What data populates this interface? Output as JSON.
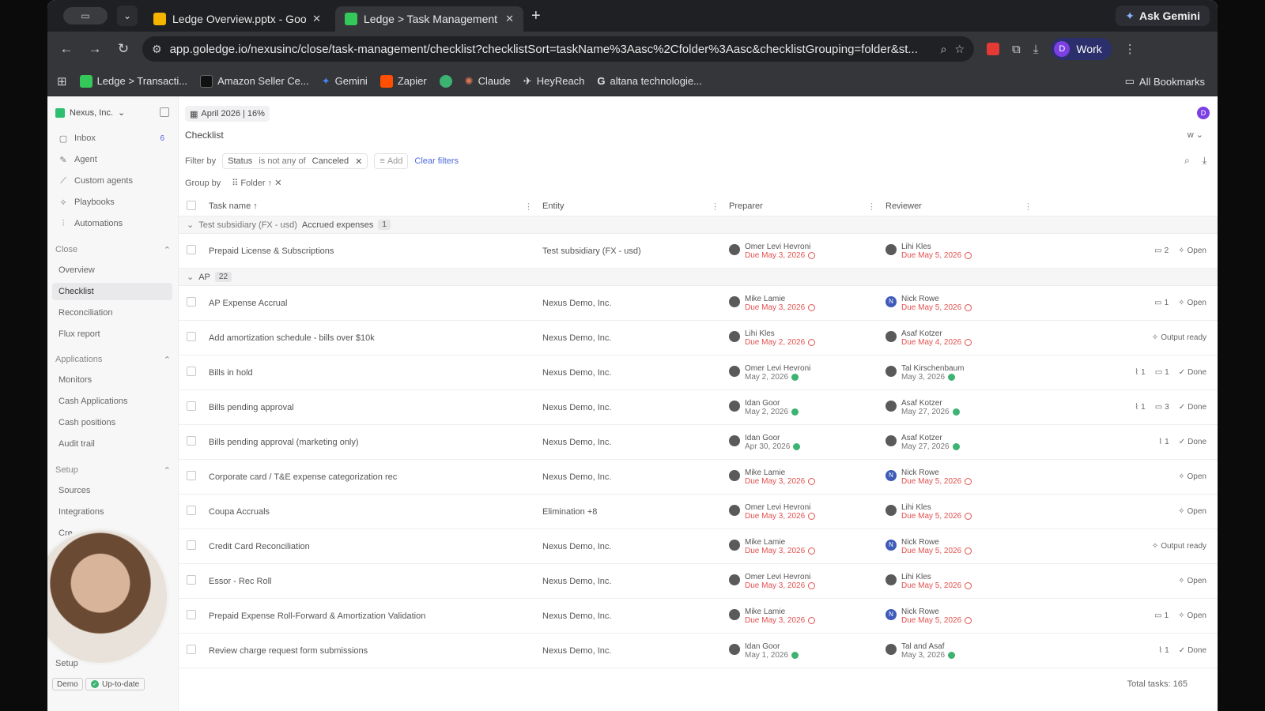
{
  "browser": {
    "tabs": [
      {
        "title": "Ledge Overview.pptx - Googl",
        "color": "#f4b400",
        "active": false
      },
      {
        "title": "Ledge > Task Management",
        "color": "#34c759",
        "active": true
      }
    ],
    "ask_gemini": "Ask Gemini",
    "url": "app.goledge.io/nexusinc/close/task-management/checklist?checklistSort=taskName%3Aasc%2Cfolder%3Aasc&checklistGrouping=folder&st...",
    "profile_label": "Work",
    "profile_initial": "D",
    "bookmarks": [
      {
        "label": "Ledge > Transacti...",
        "color": "#34c759"
      },
      {
        "label": "Amazon Seller Ce...",
        "color": "#111111"
      },
      {
        "label": "Gemini",
        "color": "#4285f4"
      },
      {
        "label": "Zapier",
        "color": "#ff4f00"
      },
      {
        "label": "",
        "color": "#3cb371"
      },
      {
        "label": "Claude",
        "color": "#d97757"
      },
      {
        "label": "HeyReach",
        "color": "#dddddd"
      },
      {
        "label": "altana technologie...",
        "color": "#ffffff"
      }
    ],
    "all_bookmarks": "All Bookmarks"
  },
  "sidebar": {
    "org": "Nexus, Inc.",
    "top_items": [
      {
        "label": "Inbox",
        "icon": "inbox-icon",
        "badge": "6"
      },
      {
        "label": "Agent",
        "icon": "agent-icon"
      },
      {
        "label": "Custom agents",
        "icon": "custom-agents-icon"
      },
      {
        "label": "Playbooks",
        "icon": "playbooks-icon"
      },
      {
        "label": "Automations",
        "icon": "automations-icon"
      }
    ],
    "close_label": "Close",
    "close_items": [
      "Overview",
      "Checklist",
      "Reconciliation",
      "Flux report"
    ],
    "applications_label": "Applications",
    "application_items": [
      "Monitors",
      "Cash Applications",
      "Cash positions",
      "Audit trail"
    ],
    "setup_label": "Setup",
    "setup_items": [
      "Sources",
      "Integrations",
      "Cre"
    ],
    "setup_bottom": "Setup",
    "demo": "Demo",
    "uptodate": "Up-to-date"
  },
  "main": {
    "period": "April 2026 | 16%",
    "title": "Checklist",
    "user_initial": "D",
    "view": "w",
    "filter": {
      "label": "Filter by",
      "field": "Status",
      "op": "is not any of",
      "value": "Canceled",
      "add": "Add",
      "clear": "Clear filters"
    },
    "group": {
      "label": "Group by",
      "value": "Folder"
    },
    "columns": {
      "task": "Task name",
      "entity": "Entity",
      "preparer": "Preparer",
      "reviewer": "Reviewer"
    },
    "total": "Total tasks: 165"
  },
  "groups": [
    {
      "path": "Test subsidiary (FX - usd)",
      "name": "Accrued expenses",
      "count": "1",
      "rows": [
        {
          "task": "Prepaid License & Subscriptions",
          "entity": "Test subsidiary (FX - usd)",
          "prep": "Omer Levi Hevroni",
          "prep_due": "Due May 3, 2026",
          "prep_done": false,
          "rev": "Lihi Kles",
          "rev_due": "Due May 5, 2026",
          "rev_done": false,
          "rev_n": false,
          "attach": "",
          "comments": "2",
          "status": "Open"
        }
      ]
    },
    {
      "path": "",
      "name": "AP",
      "count": "22",
      "rows": [
        {
          "task": "AP Expense Accrual",
          "entity": "Nexus Demo, Inc.",
          "prep": "Mike Lamie",
          "prep_due": "Due May 3, 2026",
          "prep_done": false,
          "rev": "Nick Rowe",
          "rev_due": "Due May 5, 2026",
          "rev_done": false,
          "rev_n": true,
          "attach": "",
          "comments": "1",
          "status": "Open"
        },
        {
          "task": "Add amortization schedule - bills over $10k",
          "entity": "Nexus Demo, Inc.",
          "prep": "Lihi Kles",
          "prep_due": "Due May 2, 2026",
          "prep_done": false,
          "rev": "Asaf Kotzer",
          "rev_due": "Due May 4, 2026",
          "rev_done": false,
          "rev_n": false,
          "attach": "",
          "comments": "",
          "status": "Output ready"
        },
        {
          "task": "Bills in hold",
          "entity": "Nexus Demo, Inc.",
          "prep": "Omer Levi Hevroni",
          "prep_due": "May 2, 2026",
          "prep_done": true,
          "rev": "Tal Kirschenbaum",
          "rev_due": "May 3, 2026",
          "rev_done": true,
          "rev_n": false,
          "attach": "1",
          "comments": "1",
          "status": "Done"
        },
        {
          "task": "Bills pending approval",
          "entity": "Nexus Demo, Inc.",
          "prep": "Idan Goor",
          "prep_due": "May 2, 2026",
          "prep_done": true,
          "rev": "Asaf Kotzer",
          "rev_due": "May 27, 2026",
          "rev_done": true,
          "rev_n": false,
          "attach": "1",
          "comments": "3",
          "status": "Done"
        },
        {
          "task": "Bills pending approval (marketing only)",
          "entity": "Nexus Demo, Inc.",
          "prep": "Idan Goor",
          "prep_due": "Apr 30, 2026",
          "prep_done": true,
          "rev": "Asaf Kotzer",
          "rev_due": "May 27, 2026",
          "rev_done": true,
          "rev_n": false,
          "attach": "1",
          "comments": "",
          "status": "Done"
        },
        {
          "task": "Corporate card / T&E expense categorization rec",
          "entity": "Nexus Demo, Inc.",
          "prep": "Mike Lamie",
          "prep_due": "Due May 3, 2026",
          "prep_done": false,
          "rev": "Nick Rowe",
          "rev_due": "Due May 5, 2026",
          "rev_done": false,
          "rev_n": true,
          "attach": "",
          "comments": "",
          "status": "Open"
        },
        {
          "task": "Coupa Accruals",
          "entity": "Elimination  +8",
          "prep": "Omer Levi Hevroni",
          "prep_due": "Due May 3, 2026",
          "prep_done": false,
          "rev": "Lihi Kles",
          "rev_due": "Due May 5, 2026",
          "rev_done": false,
          "rev_n": false,
          "attach": "",
          "comments": "",
          "status": "Open"
        },
        {
          "task": "Credit Card Reconciliation",
          "entity": "Nexus Demo, Inc.",
          "prep": "Mike Lamie",
          "prep_due": "Due May 3, 2026",
          "prep_done": false,
          "rev": "Nick Rowe",
          "rev_due": "Due May 5, 2026",
          "rev_done": false,
          "rev_n": true,
          "attach": "",
          "comments": "",
          "status": "Output ready"
        },
        {
          "task": "Essor - Rec Roll",
          "entity": "Nexus Demo, Inc.",
          "prep": "Omer Levi Hevroni",
          "prep_due": "Due May 3, 2026",
          "prep_done": false,
          "rev": "Lihi Kles",
          "rev_due": "Due May 5, 2026",
          "rev_done": false,
          "rev_n": false,
          "attach": "",
          "comments": "",
          "status": "Open"
        },
        {
          "task": "Prepaid Expense Roll-Forward & Amortization Validation",
          "entity": "Nexus Demo, Inc.",
          "prep": "Mike Lamie",
          "prep_due": "Due May 3, 2026",
          "prep_done": false,
          "rev": "Nick Rowe",
          "rev_due": "Due May 5, 2026",
          "rev_done": false,
          "rev_n": true,
          "attach": "",
          "comments": "1",
          "status": "Open"
        },
        {
          "task": "Review charge request form submissions",
          "entity": "Nexus Demo, Inc.",
          "prep": "Idan Goor",
          "prep_due": "May 1, 2026",
          "prep_done": true,
          "rev": "Tal and Asaf",
          "rev_due": "May 3, 2026",
          "rev_done": true,
          "rev_n": false,
          "attach": "1",
          "comments": "",
          "status": "Done"
        }
      ]
    }
  ]
}
